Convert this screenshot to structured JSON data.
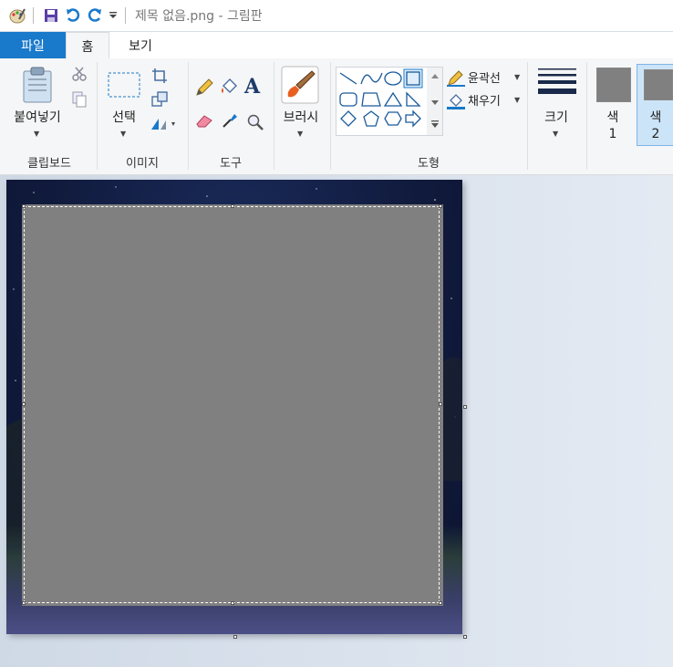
{
  "title": "제목 없음.png - 그림판",
  "tabs": {
    "file": "파일",
    "home": "홈",
    "view": "보기"
  },
  "clipboard": {
    "paste": "붙여넣기",
    "group": "클립보드"
  },
  "image": {
    "select": "선택",
    "group": "이미지"
  },
  "tools": {
    "group": "도구",
    "text_glyph": "A"
  },
  "brush": {
    "label": "브러시"
  },
  "shapes": {
    "group": "도형",
    "outline": "윤곽선",
    "fill": "채우기"
  },
  "size": {
    "label": "크기"
  },
  "color1": {
    "label": "색",
    "num": "1",
    "value": "#808080"
  },
  "color2": {
    "label": "색",
    "num": "2",
    "value": "#808080"
  },
  "colors": {
    "accent": "#1979ca",
    "selection": "#808080"
  }
}
